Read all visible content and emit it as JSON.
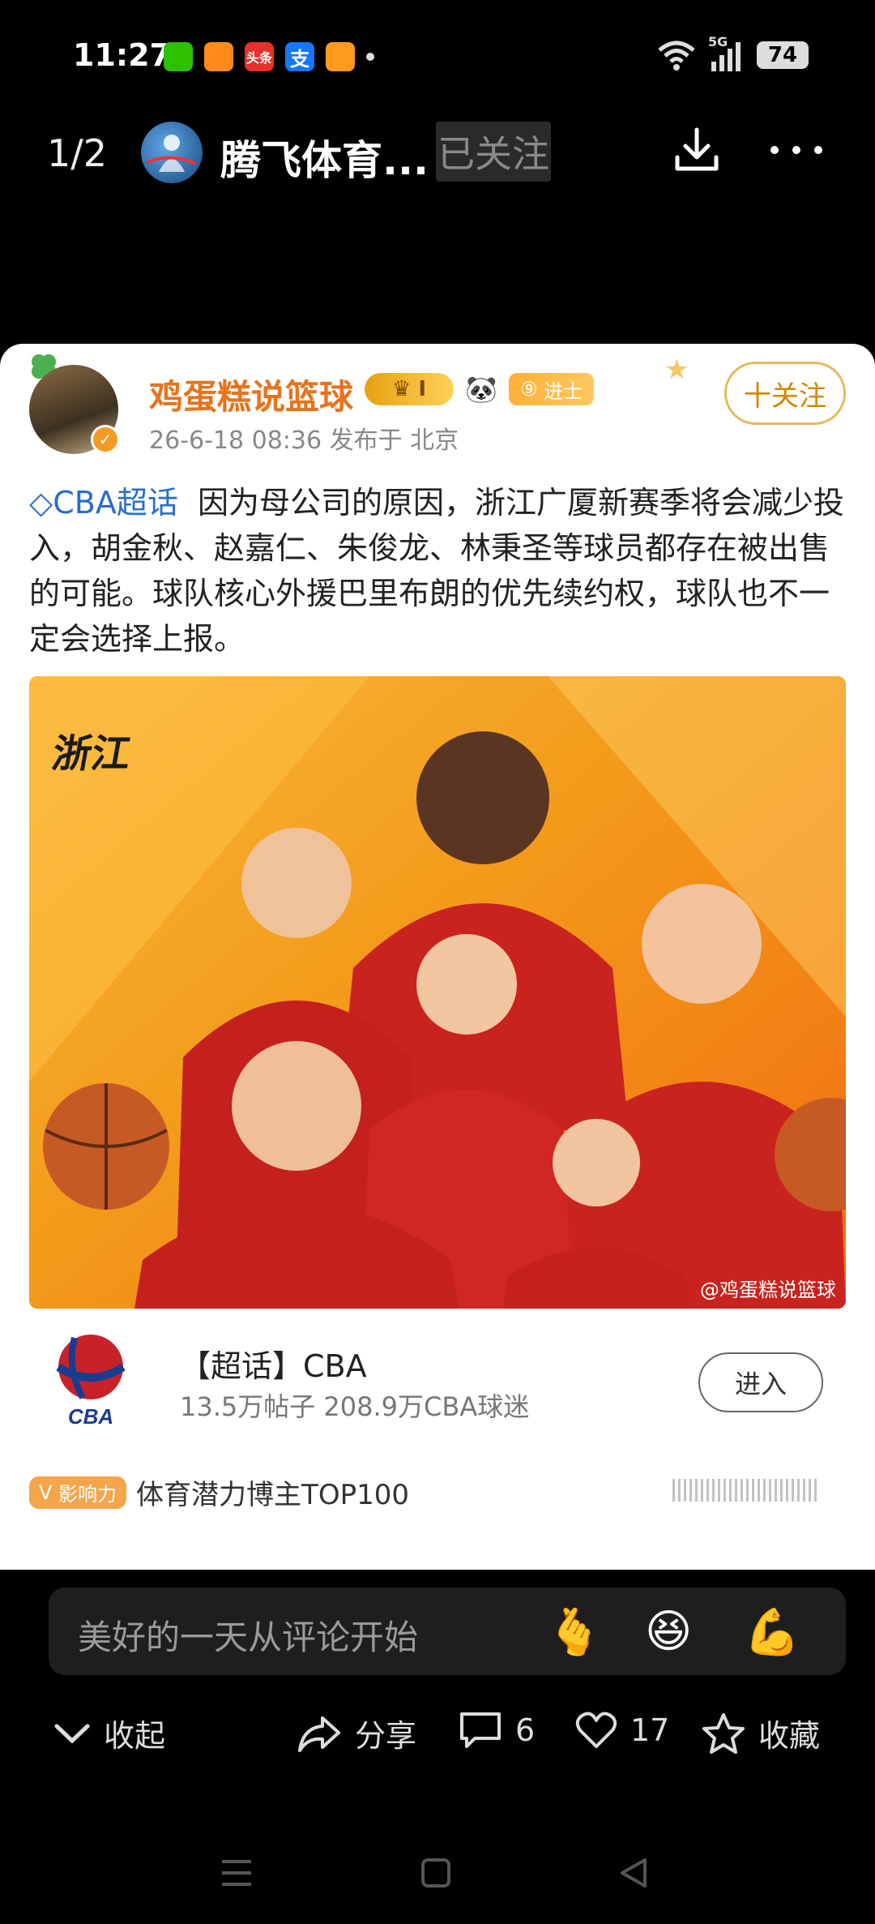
{
  "status_bar": {
    "time": "11:27",
    "network": "5G",
    "battery": "74",
    "app_icons": [
      {
        "name": "wechat-icon",
        "color": "#2dc100"
      },
      {
        "name": "gift-app-icon",
        "color": "#ff8a1c"
      },
      {
        "name": "toutiao-icon",
        "color": "#e8302c",
        "label": "头条"
      },
      {
        "name": "alipay-icon",
        "color": "#1677ff",
        "label": "支"
      },
      {
        "name": "video-app-icon",
        "color": "#ff9a1c"
      }
    ]
  },
  "top_nav": {
    "page_indicator": "1/2",
    "title": "腾飞体育...",
    "follow_state": "已关注"
  },
  "post": {
    "author": "鸡蛋糕说篮球",
    "crown_badge": "I",
    "level_badge": "进士",
    "meta": "26-6-18 08:36  发布于 北京",
    "follow_label": "十关注",
    "topic_tag": "CBA超话",
    "body": "因为母公司的原因，浙江广厦新赛季将会减少投入，胡金秋、赵嘉仁、朱俊龙、林秉圣等球员都存在被出售的可能。球队核心外援巴里布朗的优先续约权，球队也不一定会选择上报。",
    "image": {
      "team_logo_text": "浙江",
      "watermark": "@鸡蛋糕说篮球"
    }
  },
  "topic_card": {
    "logo_text": "CBA",
    "title": "【超话】CBA",
    "stats": "13.5万帖子 208.9万CBA球迷",
    "enter_label": "进入"
  },
  "influence": {
    "badge": "影响力",
    "text": "体育潜力博主TOP100"
  },
  "comment": {
    "placeholder": "美好的一天从评论开始",
    "emojis": [
      "🫰",
      "😆",
      "💪"
    ]
  },
  "actions": {
    "collapse": "收起",
    "share": "分享",
    "comments": "6",
    "likes": "17",
    "favorite": "收藏"
  }
}
